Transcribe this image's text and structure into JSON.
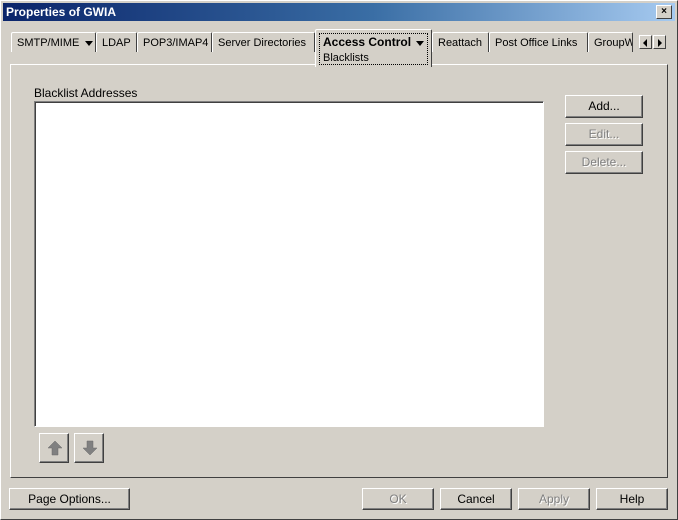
{
  "window": {
    "title": "Properties of GWIA",
    "close_label": "×"
  },
  "tabs": [
    {
      "label": "SMTP/MIME",
      "has_menu": true
    },
    {
      "label": "LDAP"
    },
    {
      "label": "POP3/IMAP4"
    },
    {
      "label": "Server Directories"
    },
    {
      "label": "Access Control",
      "has_menu": true,
      "active": true,
      "subpage": "Blacklists"
    },
    {
      "label": "Reattach"
    },
    {
      "label": "Post Office Links"
    },
    {
      "label": "GroupW"
    }
  ],
  "content": {
    "list_label": "Blacklist Addresses",
    "buttons": {
      "add": "Add...",
      "edit": "Edit...",
      "delete": "Delete..."
    }
  },
  "footer": {
    "page_options": "Page Options...",
    "ok": "OK",
    "cancel": "Cancel",
    "apply": "Apply",
    "help": "Help"
  }
}
